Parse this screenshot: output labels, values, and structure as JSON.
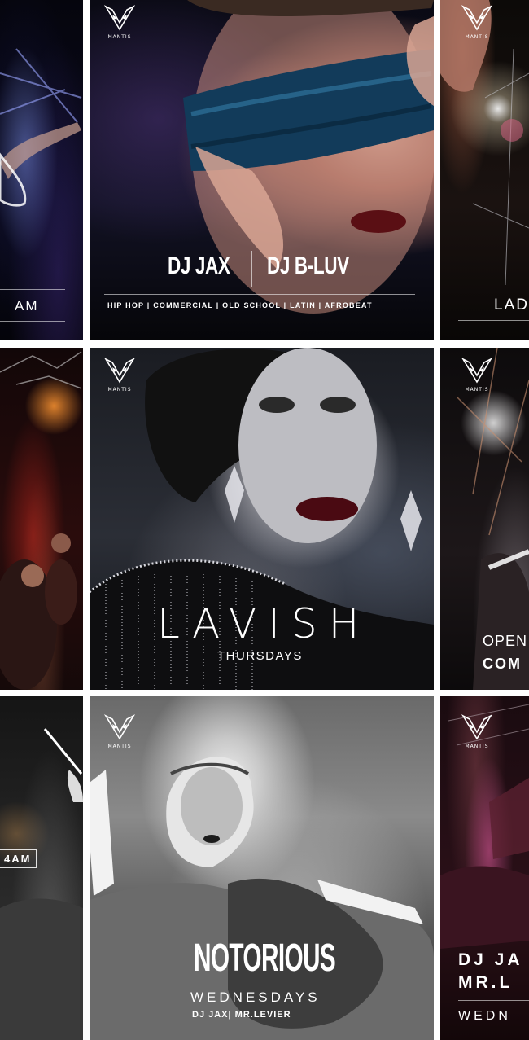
{
  "brand": {
    "name": "MANTIS"
  },
  "tiles": {
    "r1c1": {
      "text": "AM"
    },
    "r1c2": {
      "dj1": "DJ JAX",
      "dj2": "DJ B-LUV",
      "genres": "HIP HOP | COMMERCIAL | OLD SCHOOL | LATIN | AFROBEAT"
    },
    "r1c3": {
      "text": "LAD"
    },
    "r2c2": {
      "title": "LAVISH",
      "subtitle": "THURSDAYS"
    },
    "r2c3": {
      "line1": "OPEN",
      "line2": "COM"
    },
    "r3c1": {
      "text": "4AM"
    },
    "r3c2": {
      "title": "NOTORIOUS",
      "subtitle": "WEDNESDAYS",
      "djs": "DJ JAX| MR.LEVIER"
    },
    "r3c3": {
      "line1": "DJ JA",
      "line2": "MR.L",
      "line3": "WEDN"
    }
  },
  "icons": {
    "logo": "mantis-logo-icon"
  },
  "colors": {
    "background": "#ffffff",
    "text": "#ffffff"
  }
}
